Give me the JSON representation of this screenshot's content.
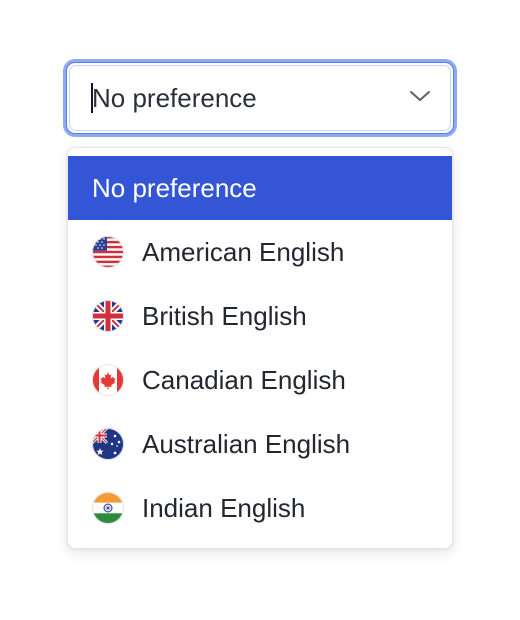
{
  "select": {
    "value": "No preference",
    "chevron_icon": "chevron-down-icon"
  },
  "menu": {
    "options": [
      {
        "label": "No preference",
        "flag": null,
        "selected": true
      },
      {
        "label": "American English",
        "flag": "us-flag-icon",
        "selected": false
      },
      {
        "label": "British English",
        "flag": "uk-flag-icon",
        "selected": false
      },
      {
        "label": "Canadian English",
        "flag": "canada-flag-icon",
        "selected": false
      },
      {
        "label": "Australian English",
        "flag": "australia-flag-icon",
        "selected": false
      },
      {
        "label": "Indian English",
        "flag": "india-flag-icon",
        "selected": false
      }
    ]
  },
  "colors": {
    "accent": "#3355d6",
    "focus_ring": "#8ea9f3",
    "text": "#23272f",
    "menu_border": "#e3e5ea"
  }
}
